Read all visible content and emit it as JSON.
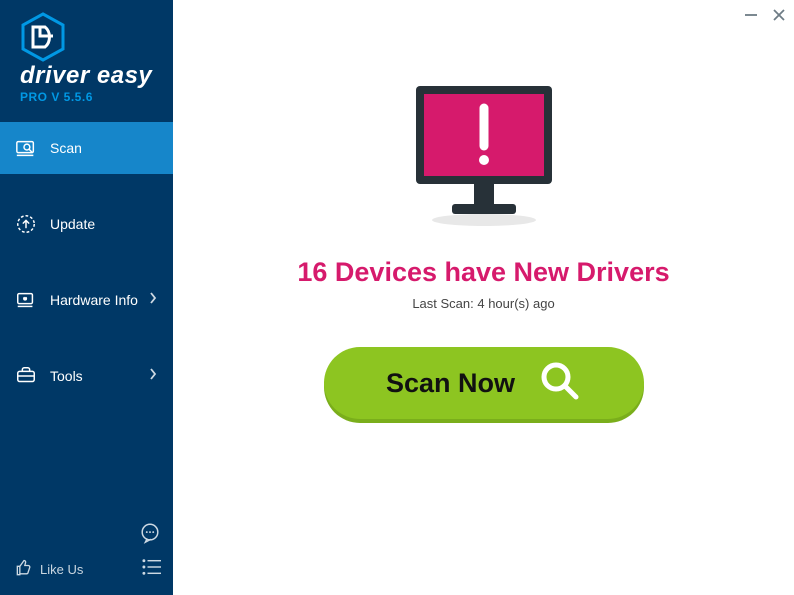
{
  "brand": "driver easy",
  "version": "PRO V 5.5.6",
  "nav": {
    "scan": "Scan",
    "update": "Update",
    "hardware": "Hardware Info",
    "tools": "Tools"
  },
  "likeUs": "Like Us",
  "headline": "16 Devices have New Drivers",
  "lastScan": "Last Scan: 4 hour(s) ago",
  "scanButton": "Scan Now"
}
